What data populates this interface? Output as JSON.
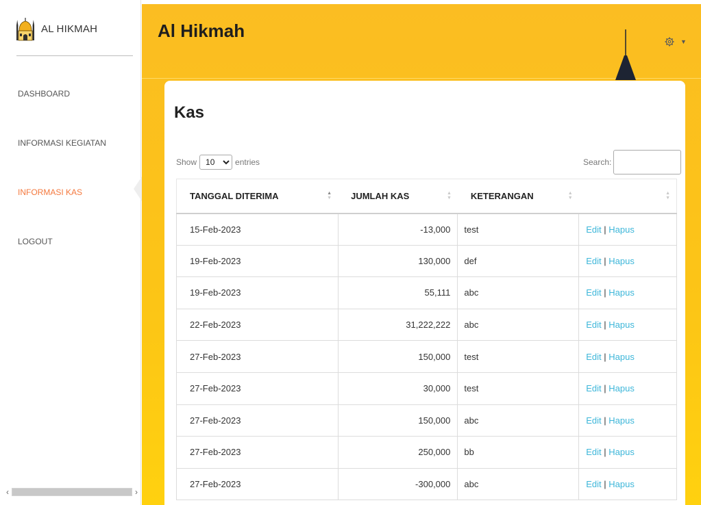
{
  "brand": {
    "name": "AL HIKMAH",
    "logo_icon": "mosque-icon"
  },
  "sidebar": {
    "items": [
      {
        "label": "DASHBOARD",
        "active": false
      },
      {
        "label": "INFORMASI KEGIATAN",
        "active": false
      },
      {
        "label": "INFORMASI KAS",
        "active": true
      },
      {
        "label": "LOGOUT",
        "active": false
      }
    ]
  },
  "header": {
    "title": "Al Hikmah",
    "settings_icon": "gear-icon",
    "dropdown_icon": "caret-down-icon"
  },
  "page": {
    "title": "Kas"
  },
  "datatable": {
    "length_prefix": "Show",
    "length_value": "10",
    "length_suffix": "entries",
    "search_label": "Search:",
    "search_value": ""
  },
  "table": {
    "columns": [
      "TANGGAL DITERIMA",
      "JUMLAH KAS",
      "KETERANGAN",
      ""
    ],
    "rows": [
      {
        "tanggal": "15-Feb-2023",
        "jumlah": "-13,000",
        "keterangan": "test"
      },
      {
        "tanggal": "19-Feb-2023",
        "jumlah": "130,000",
        "keterangan": "def"
      },
      {
        "tanggal": "19-Feb-2023",
        "jumlah": "55,111",
        "keterangan": "abc"
      },
      {
        "tanggal": "22-Feb-2023",
        "jumlah": "31,222,222",
        "keterangan": "abc"
      },
      {
        "tanggal": "27-Feb-2023",
        "jumlah": "150,000",
        "keterangan": "test"
      },
      {
        "tanggal": "27-Feb-2023",
        "jumlah": "30,000",
        "keterangan": "test"
      },
      {
        "tanggal": "27-Feb-2023",
        "jumlah": "150,000",
        "keterangan": "abc"
      },
      {
        "tanggal": "27-Feb-2023",
        "jumlah": "250,000",
        "keterangan": "bb"
      },
      {
        "tanggal": "27-Feb-2023",
        "jumlah": "-300,000",
        "keterangan": "abc"
      }
    ],
    "edit_label": "Edit",
    "separator": "|",
    "delete_label": "Hapus"
  },
  "colors": {
    "accent": "#fcc516",
    "active_nav": "#f4783d",
    "link": "#3cb6d9"
  }
}
